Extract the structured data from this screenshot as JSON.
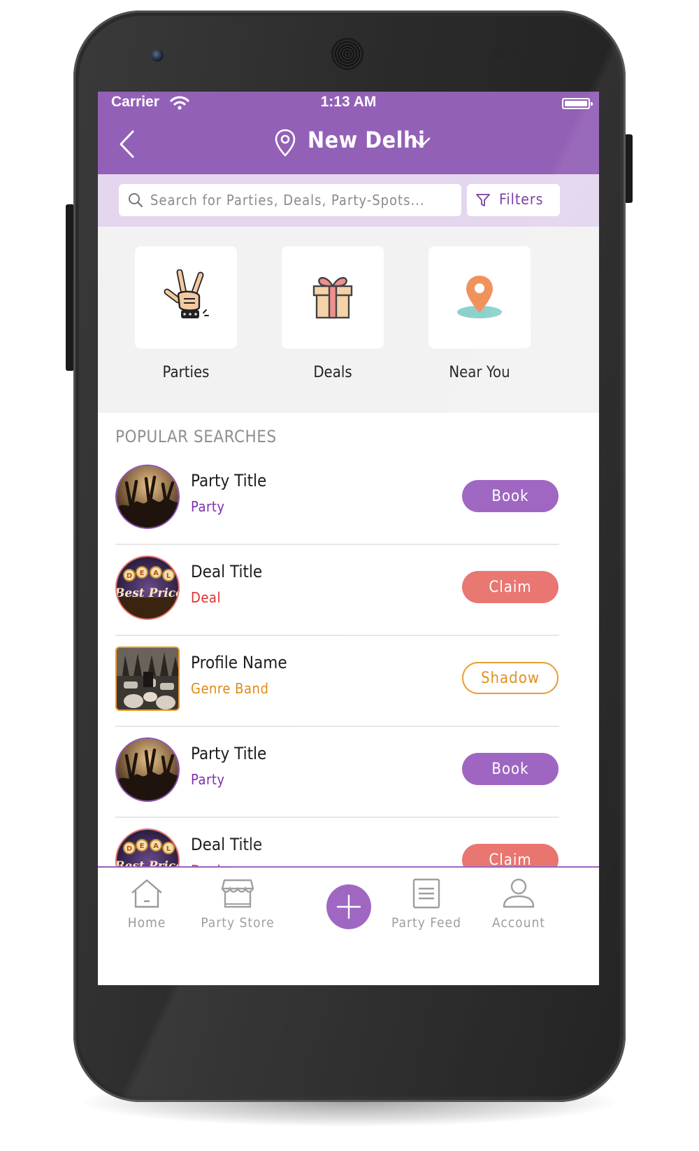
{
  "status_bar": {
    "carrier": "Carrier",
    "time": "1:13 AM"
  },
  "nav_bar": {
    "city": "New Delhi"
  },
  "search": {
    "placeholder": "Search for Parties, Deals, Party-Spots...",
    "filter_label": "Filters"
  },
  "categories": [
    {
      "label": "Parties",
      "icon": "rock-hand-icon"
    },
    {
      "label": "Deals",
      "icon": "gift-icon"
    },
    {
      "label": "Near You",
      "icon": "map-pin-icon"
    }
  ],
  "popular": {
    "title": "POPULAR SEARCHES",
    "items": [
      {
        "title": "Party Title",
        "subtitle": "Party",
        "action": "Book",
        "subtitle_color": "#7b2fb0"
      },
      {
        "title": "Deal Title",
        "subtitle": "Deal",
        "action": "Claim",
        "subtitle_color": "#e02f2f",
        "badge_letters": [
          "D",
          "E",
          "A",
          "L"
        ],
        "badge_text": "Best Price"
      },
      {
        "title": "Profile Name",
        "subtitle": "Genre Band",
        "action": "Shadow",
        "subtitle_color": "#e08a15"
      },
      {
        "title": "Party Title",
        "subtitle": "Party",
        "action": "Book",
        "subtitle_color": "#7b2fb0"
      },
      {
        "title": "Deal Title",
        "subtitle": "Deal",
        "action": "Claim",
        "subtitle_color": "#e02f2f",
        "badge_letters": [
          "D",
          "E",
          "A",
          "L"
        ],
        "badge_text": "Best Price"
      }
    ]
  },
  "tabbar": {
    "items": [
      {
        "label": "Home",
        "icon": "home-icon"
      },
      {
        "label": "Party Store",
        "icon": "store-icon"
      },
      {
        "label": "Party Feed",
        "icon": "feed-icon"
      },
      {
        "label": "Account",
        "icon": "account-icon"
      }
    ],
    "center_icon": "plus-icon"
  },
  "colors": {
    "brand": "#9360b7",
    "book": "#9a5fbf",
    "claim": "#e8706b",
    "shadow": "#e08a15"
  }
}
